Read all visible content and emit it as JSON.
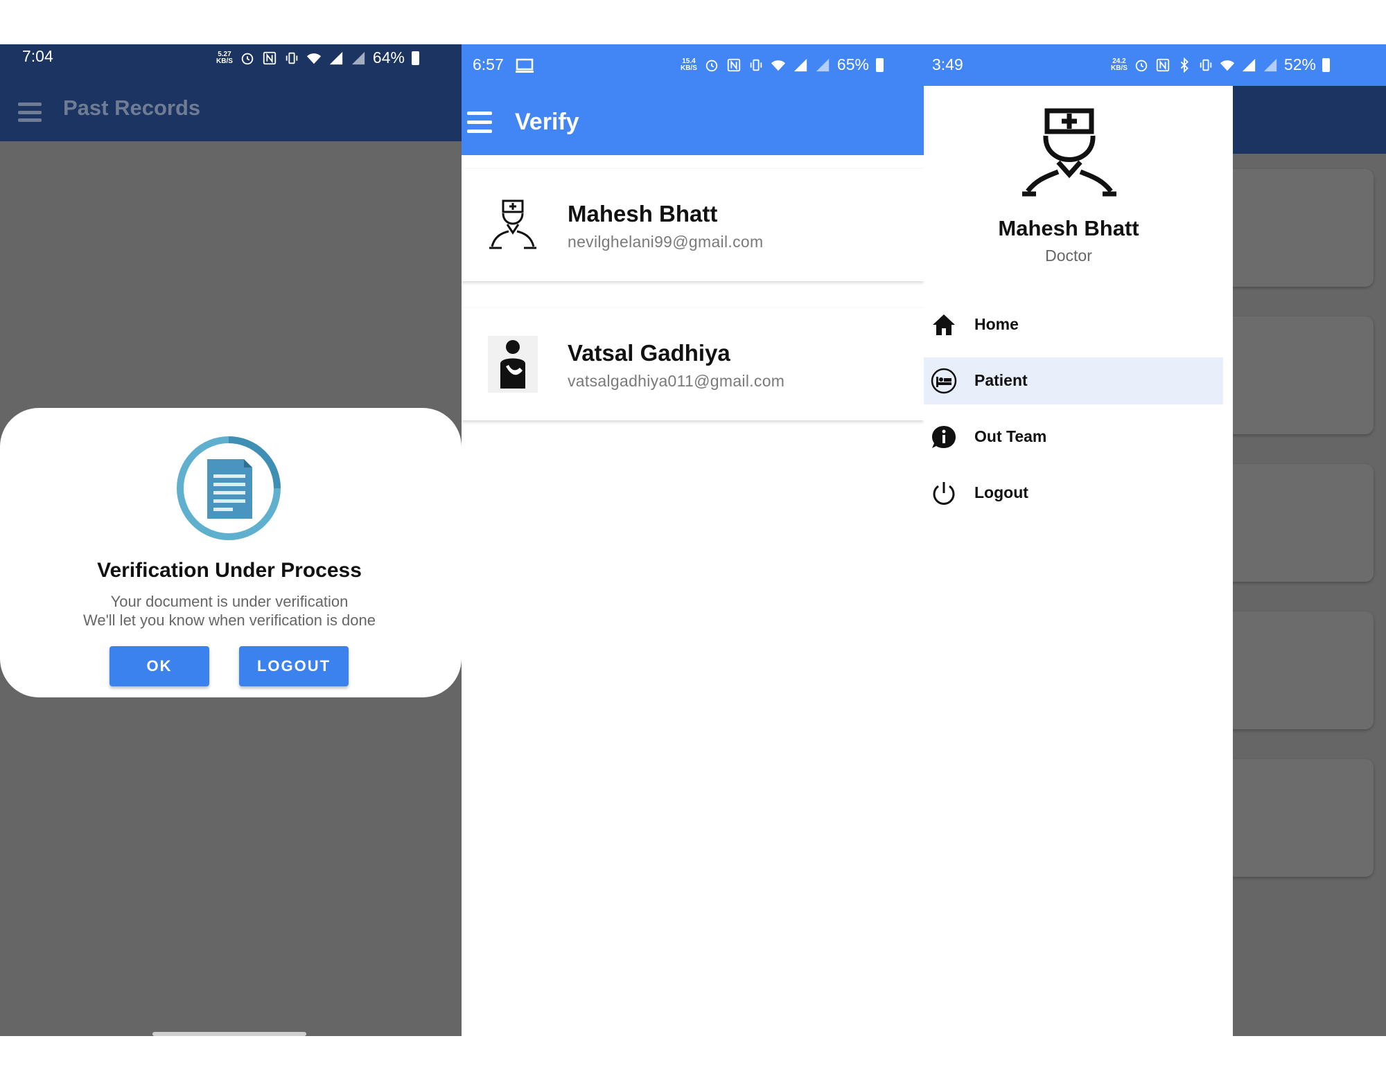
{
  "screens": {
    "past_records": {
      "status": {
        "time": "7:04",
        "speed": "5.27",
        "speed_unit": "KB/S",
        "battery": "64%"
      },
      "appbar_title": "Past Records",
      "dialog": {
        "title": "Verification Under Process",
        "line1": "Your document is under verification",
        "line2": "We'll let you know when verification is done",
        "ok_label": "OK",
        "logout_label": "LOGOUT"
      }
    },
    "verify": {
      "status": {
        "time": "6:57",
        "speed": "15.4",
        "speed_unit": "KB/S",
        "battery": "65%"
      },
      "appbar_title": "Verify",
      "users": [
        {
          "name": "Mahesh Bhatt",
          "email": "nevilghelani99@gmail.com",
          "icon": "doctor-icon"
        },
        {
          "name": "Vatsal Gadhiya",
          "email": "vatsalgadhiya011@gmail.com",
          "icon": "patient-icon"
        }
      ]
    },
    "drawer": {
      "status": {
        "time": "3:49",
        "speed": "24.2",
        "speed_unit": "KB/S",
        "battery": "52%"
      },
      "profile": {
        "name": "Mahesh Bhatt",
        "role": "Doctor",
        "icon": "doctor-icon"
      },
      "menu": [
        {
          "label": "Home",
          "icon": "home-icon",
          "active": false
        },
        {
          "label": "Patient",
          "icon": "bed-icon",
          "active": true
        },
        {
          "label": "Out Team",
          "icon": "info-bubble-icon",
          "active": false
        },
        {
          "label": "Logout",
          "icon": "power-icon",
          "active": false
        }
      ]
    }
  },
  "colors": {
    "dark_navy": "#1b3461",
    "primary_blue": "#4285f4",
    "button_blue": "#3c82ee",
    "scrim_gray": "#666666",
    "active_item_bg": "#e8effb"
  }
}
